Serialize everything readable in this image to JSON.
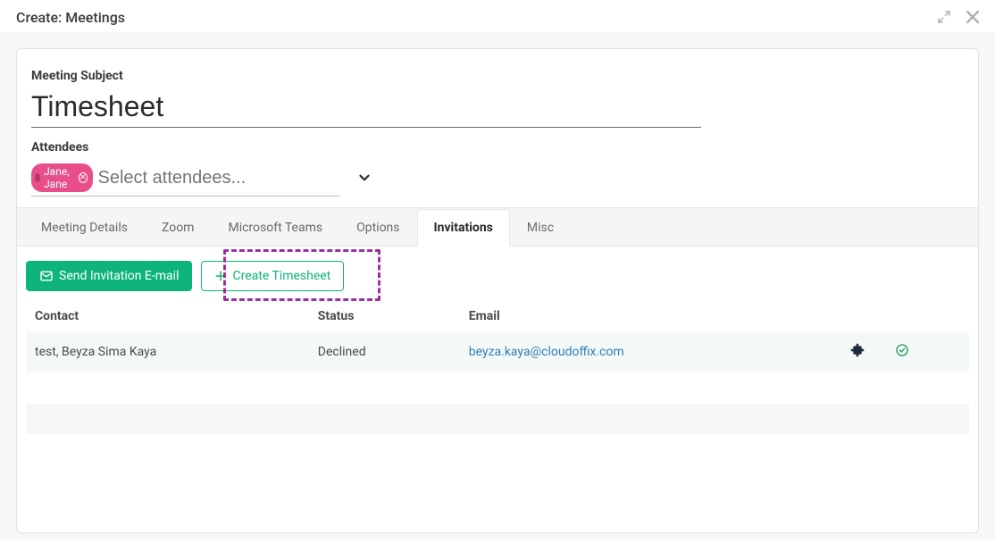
{
  "dialog": {
    "title": "Create: Meetings"
  },
  "form": {
    "subject_label": "Meeting Subject",
    "subject_value": "Timesheet",
    "attendees_label": "Attendees",
    "attendees_placeholder": "Select attendees...",
    "attendee_chip": "Jane, Jane"
  },
  "tabs": {
    "items": [
      {
        "label": "Meeting Details"
      },
      {
        "label": "Zoom"
      },
      {
        "label": "Microsoft Teams"
      },
      {
        "label": "Options"
      },
      {
        "label": "Invitations"
      },
      {
        "label": "Misc"
      }
    ],
    "active_index": 4
  },
  "invitations": {
    "send_email_label": "Send Invitation E-mail",
    "create_timesheet_label": "Create Timesheet",
    "columns": {
      "contact": "Contact",
      "status": "Status",
      "email": "Email"
    },
    "rows": [
      {
        "contact": "test, Beyza Sima Kaya",
        "status": "Declined",
        "email": "beyza.kaya@cloudoffix.com"
      }
    ]
  },
  "colors": {
    "primary_green": "#0fb47a",
    "chip_pink": "#e84f8a",
    "highlight_purple": "#9b2fa0",
    "link_blue": "#2e7fb5",
    "row_dark_icon": "#1a2a3a",
    "row_green_icon": "#1a9a55"
  }
}
